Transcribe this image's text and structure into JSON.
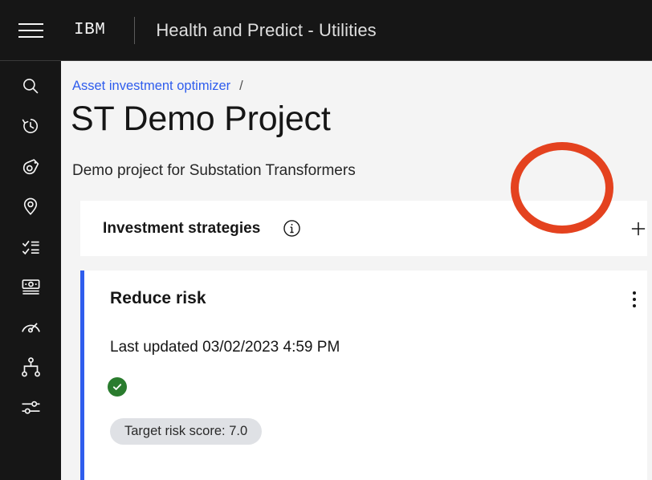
{
  "header": {
    "menu_icon": "hamburger-menu-icon",
    "brand": "IBM",
    "app_title": "Health and Predict - Utilities"
  },
  "sidebar": {
    "items": [
      {
        "icon": "search-icon",
        "label": "Search"
      },
      {
        "icon": "history-icon",
        "label": "History"
      },
      {
        "icon": "asset-icon",
        "label": "Assets"
      },
      {
        "icon": "location-pin-icon",
        "label": "Locations"
      },
      {
        "icon": "task-checklist-icon",
        "label": "Tasks"
      },
      {
        "icon": "money-bill-icon",
        "label": "Investments"
      },
      {
        "icon": "gauge-icon",
        "label": "Performance"
      },
      {
        "icon": "hierarchy-icon",
        "label": "Hierarchy"
      },
      {
        "icon": "sliders-icon",
        "label": "Settings"
      }
    ]
  },
  "breadcrumb": {
    "parent_label": "Asset investment optimizer",
    "separator": "/"
  },
  "page": {
    "title": "ST Demo Project",
    "subtitle": "Demo project for Substation Transformers"
  },
  "strategies_panel": {
    "title": "Investment strategies",
    "info_icon": "info-circle-icon",
    "add_icon": "plus-icon",
    "add_label": "Add strategy"
  },
  "strategy_card": {
    "title": "Reduce risk",
    "last_updated": "Last updated 03/02/2023 4:59 PM",
    "status_icon": "checkmark-filled-icon",
    "status_color": "#2a7c2e",
    "accent_color": "#2f5ded",
    "tags": [
      {
        "label": "Target risk score: 7.0"
      }
    ],
    "overflow_icon": "overflow-menu-vertical-icon"
  },
  "annotation": {
    "type": "highlight-ellipse",
    "color": "#e4421f",
    "target": "add-strategy-button"
  }
}
